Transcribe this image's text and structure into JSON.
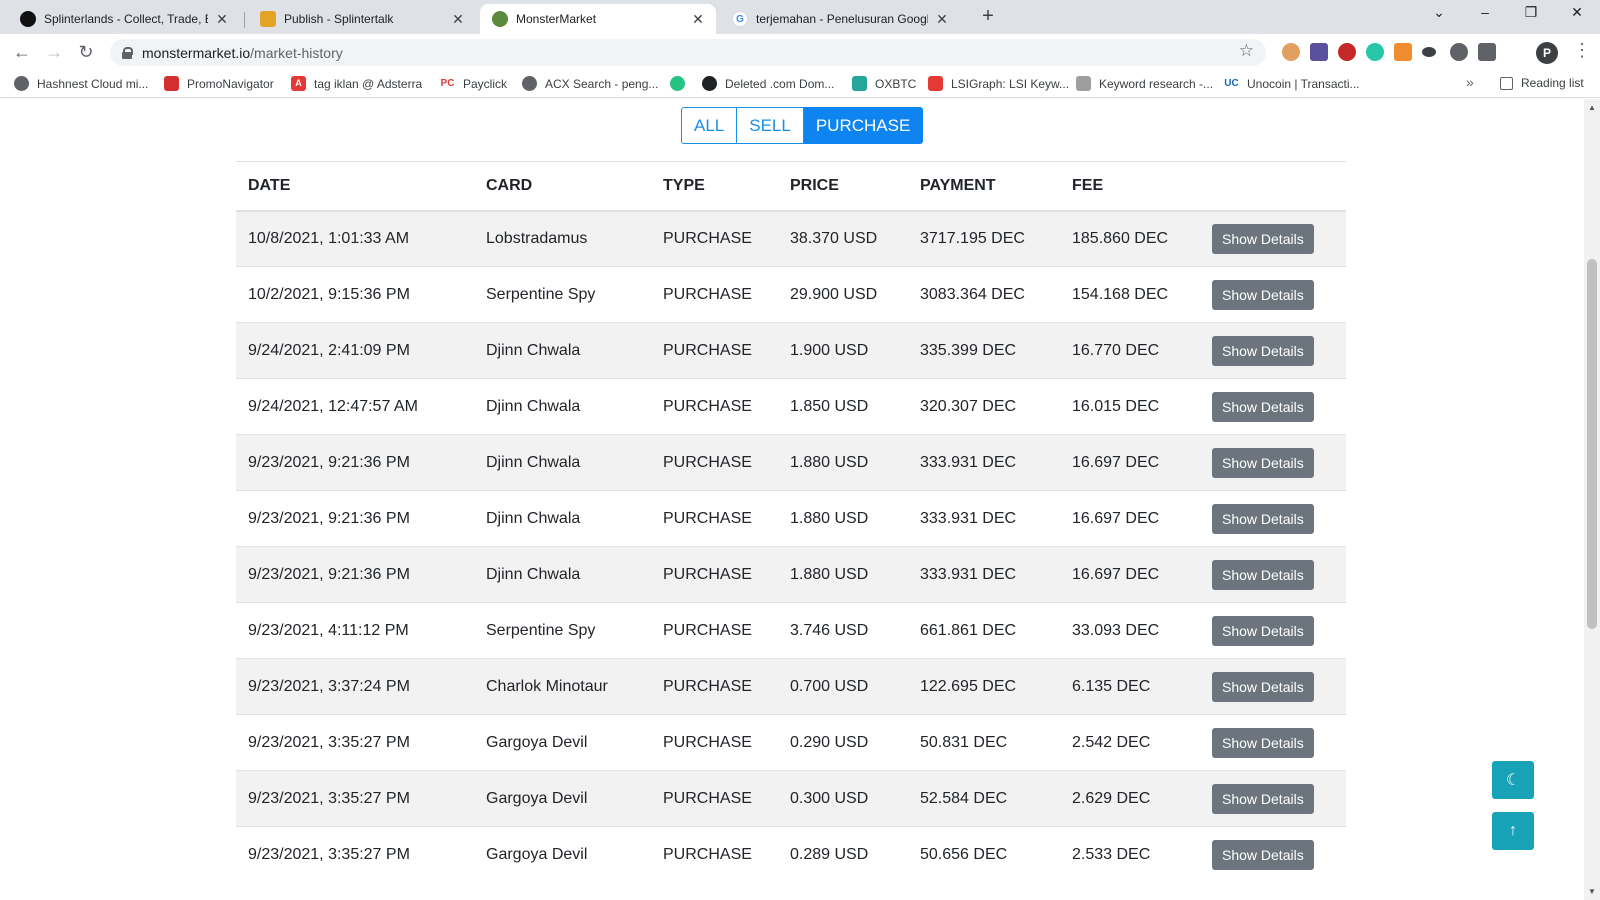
{
  "browser": {
    "tabs": [
      {
        "title": "Splinterlands - Collect, Trade, Bat",
        "close": "✕",
        "icon_color": "#111111",
        "active": false
      },
      {
        "title": "Publish - Splintertalk",
        "close": "✕",
        "icon_color": "#e2a427",
        "active": false
      },
      {
        "title": "MonsterMarket",
        "close": "✕",
        "icon_color": "#5c8a3c",
        "active": true
      },
      {
        "title": "terjemahan - Penelusuran Googl",
        "close": "✕",
        "icon_color": "#4285f4",
        "active": false
      }
    ],
    "new_tab": "+",
    "url_host": "monstermarket.io",
    "url_path": "/market-history",
    "profile_initial": "P",
    "bookmarks": [
      {
        "label": "Hashnest Cloud mi...",
        "color": "#5f6368"
      },
      {
        "label": "PromoNavigator",
        "color": "#d32f2f"
      },
      {
        "label": "tag iklan @ Adsterra",
        "color": "#e53935"
      },
      {
        "label": "Payclick",
        "color": "#e53935"
      },
      {
        "label": "ACX Search - peng...",
        "color": "#5f6368"
      },
      {
        "label": "",
        "color": "#26c281"
      },
      {
        "label": "Deleted .com Dom...",
        "color": "#202124"
      },
      {
        "label": "OXBTC",
        "color": "#26a69a"
      },
      {
        "label": "LSIGraph: LSI Keyw...",
        "color": "#e53935"
      },
      {
        "label": "Keyword research -...",
        "color": "#9e9e9e"
      },
      {
        "label": "Unocoin | Transacti...",
        "color": "#1565c0"
      }
    ],
    "bookmarks_more": "»",
    "reading_list": "Reading list"
  },
  "filters": {
    "all": "ALL",
    "sell": "SELL",
    "purchase": "PURCHASE",
    "active": "PURCHASE"
  },
  "table": {
    "headers": [
      "DATE",
      "CARD",
      "TYPE",
      "PRICE",
      "PAYMENT",
      "FEE"
    ],
    "button_label": "Show Details",
    "rows": [
      {
        "date": "10/8/2021, 1:01:33 AM",
        "card": "Lobstradamus",
        "type": "PURCHASE",
        "price": "38.370 USD",
        "payment": "3717.195 DEC",
        "fee": "185.860 DEC"
      },
      {
        "date": "10/2/2021, 9:15:36 PM",
        "card": "Serpentine Spy",
        "type": "PURCHASE",
        "price": "29.900 USD",
        "payment": "3083.364 DEC",
        "fee": "154.168 DEC"
      },
      {
        "date": "9/24/2021, 2:41:09 PM",
        "card": "Djinn Chwala",
        "type": "PURCHASE",
        "price": "1.900 USD",
        "payment": "335.399 DEC",
        "fee": "16.770 DEC"
      },
      {
        "date": "9/24/2021, 12:47:57 AM",
        "card": "Djinn Chwala",
        "type": "PURCHASE",
        "price": "1.850 USD",
        "payment": "320.307 DEC",
        "fee": "16.015 DEC"
      },
      {
        "date": "9/23/2021, 9:21:36 PM",
        "card": "Djinn Chwala",
        "type": "PURCHASE",
        "price": "1.880 USD",
        "payment": "333.931 DEC",
        "fee": "16.697 DEC"
      },
      {
        "date": "9/23/2021, 9:21:36 PM",
        "card": "Djinn Chwala",
        "type": "PURCHASE",
        "price": "1.880 USD",
        "payment": "333.931 DEC",
        "fee": "16.697 DEC"
      },
      {
        "date": "9/23/2021, 9:21:36 PM",
        "card": "Djinn Chwala",
        "type": "PURCHASE",
        "price": "1.880 USD",
        "payment": "333.931 DEC",
        "fee": "16.697 DEC"
      },
      {
        "date": "9/23/2021, 4:11:12 PM",
        "card": "Serpentine Spy",
        "type": "PURCHASE",
        "price": "3.746 USD",
        "payment": "661.861 DEC",
        "fee": "33.093 DEC"
      },
      {
        "date": "9/23/2021, 3:37:24 PM",
        "card": "Charlok Minotaur",
        "type": "PURCHASE",
        "price": "0.700 USD",
        "payment": "122.695 DEC",
        "fee": "6.135 DEC"
      },
      {
        "date": "9/23/2021, 3:35:27 PM",
        "card": "Gargoya Devil",
        "type": "PURCHASE",
        "price": "0.290 USD",
        "payment": "50.831 DEC",
        "fee": "2.542 DEC"
      },
      {
        "date": "9/23/2021, 3:35:27 PM",
        "card": "Gargoya Devil",
        "type": "PURCHASE",
        "price": "0.300 USD",
        "payment": "52.584 DEC",
        "fee": "2.629 DEC"
      },
      {
        "date": "9/23/2021, 3:35:27 PM",
        "card": "Gargoya Devil",
        "type": "PURCHASE",
        "price": "0.289 USD",
        "payment": "50.656 DEC",
        "fee": "2.533 DEC"
      }
    ]
  },
  "floating": {
    "dark_mode_icon": "moon-icon",
    "scroll_top_icon": "arrow-up-icon"
  },
  "colors": {
    "accent": "#0d84f0",
    "float_button": "#17a2b8",
    "details_button": "#6c757d"
  }
}
